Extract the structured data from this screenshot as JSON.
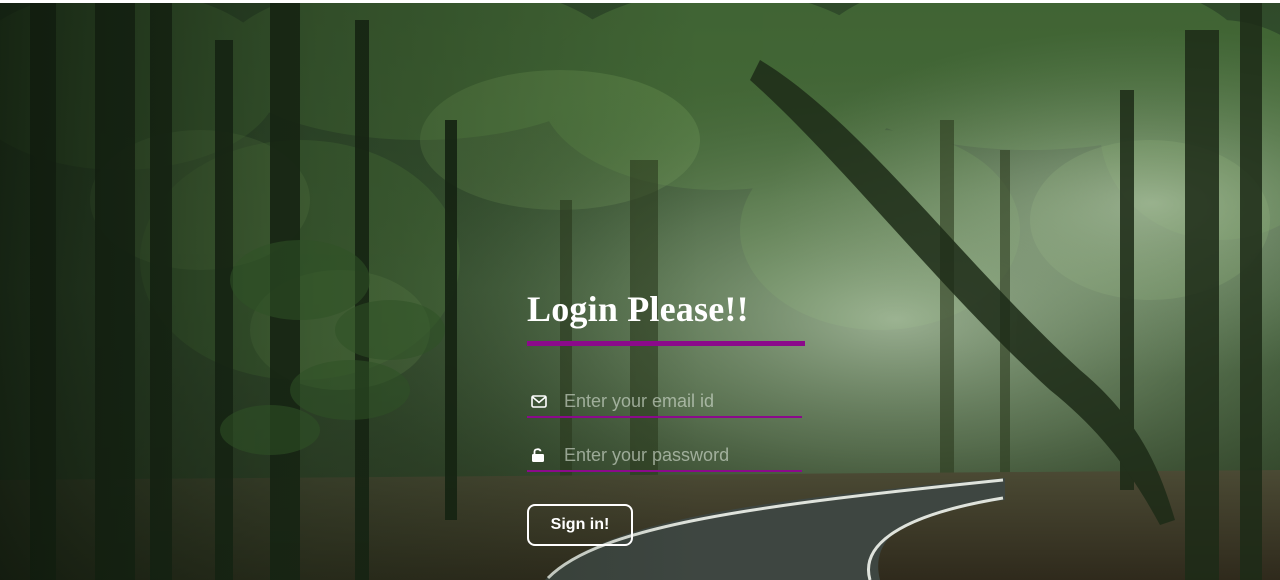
{
  "login": {
    "title": "Login Please!!",
    "accent_color": "#8b0a8b",
    "email": {
      "icon": "envelope-icon",
      "placeholder": "Enter your email id",
      "value": ""
    },
    "password": {
      "icon": "unlock-icon",
      "placeholder": "Enter your password",
      "value": ""
    },
    "submit_label": "Sign in!"
  }
}
